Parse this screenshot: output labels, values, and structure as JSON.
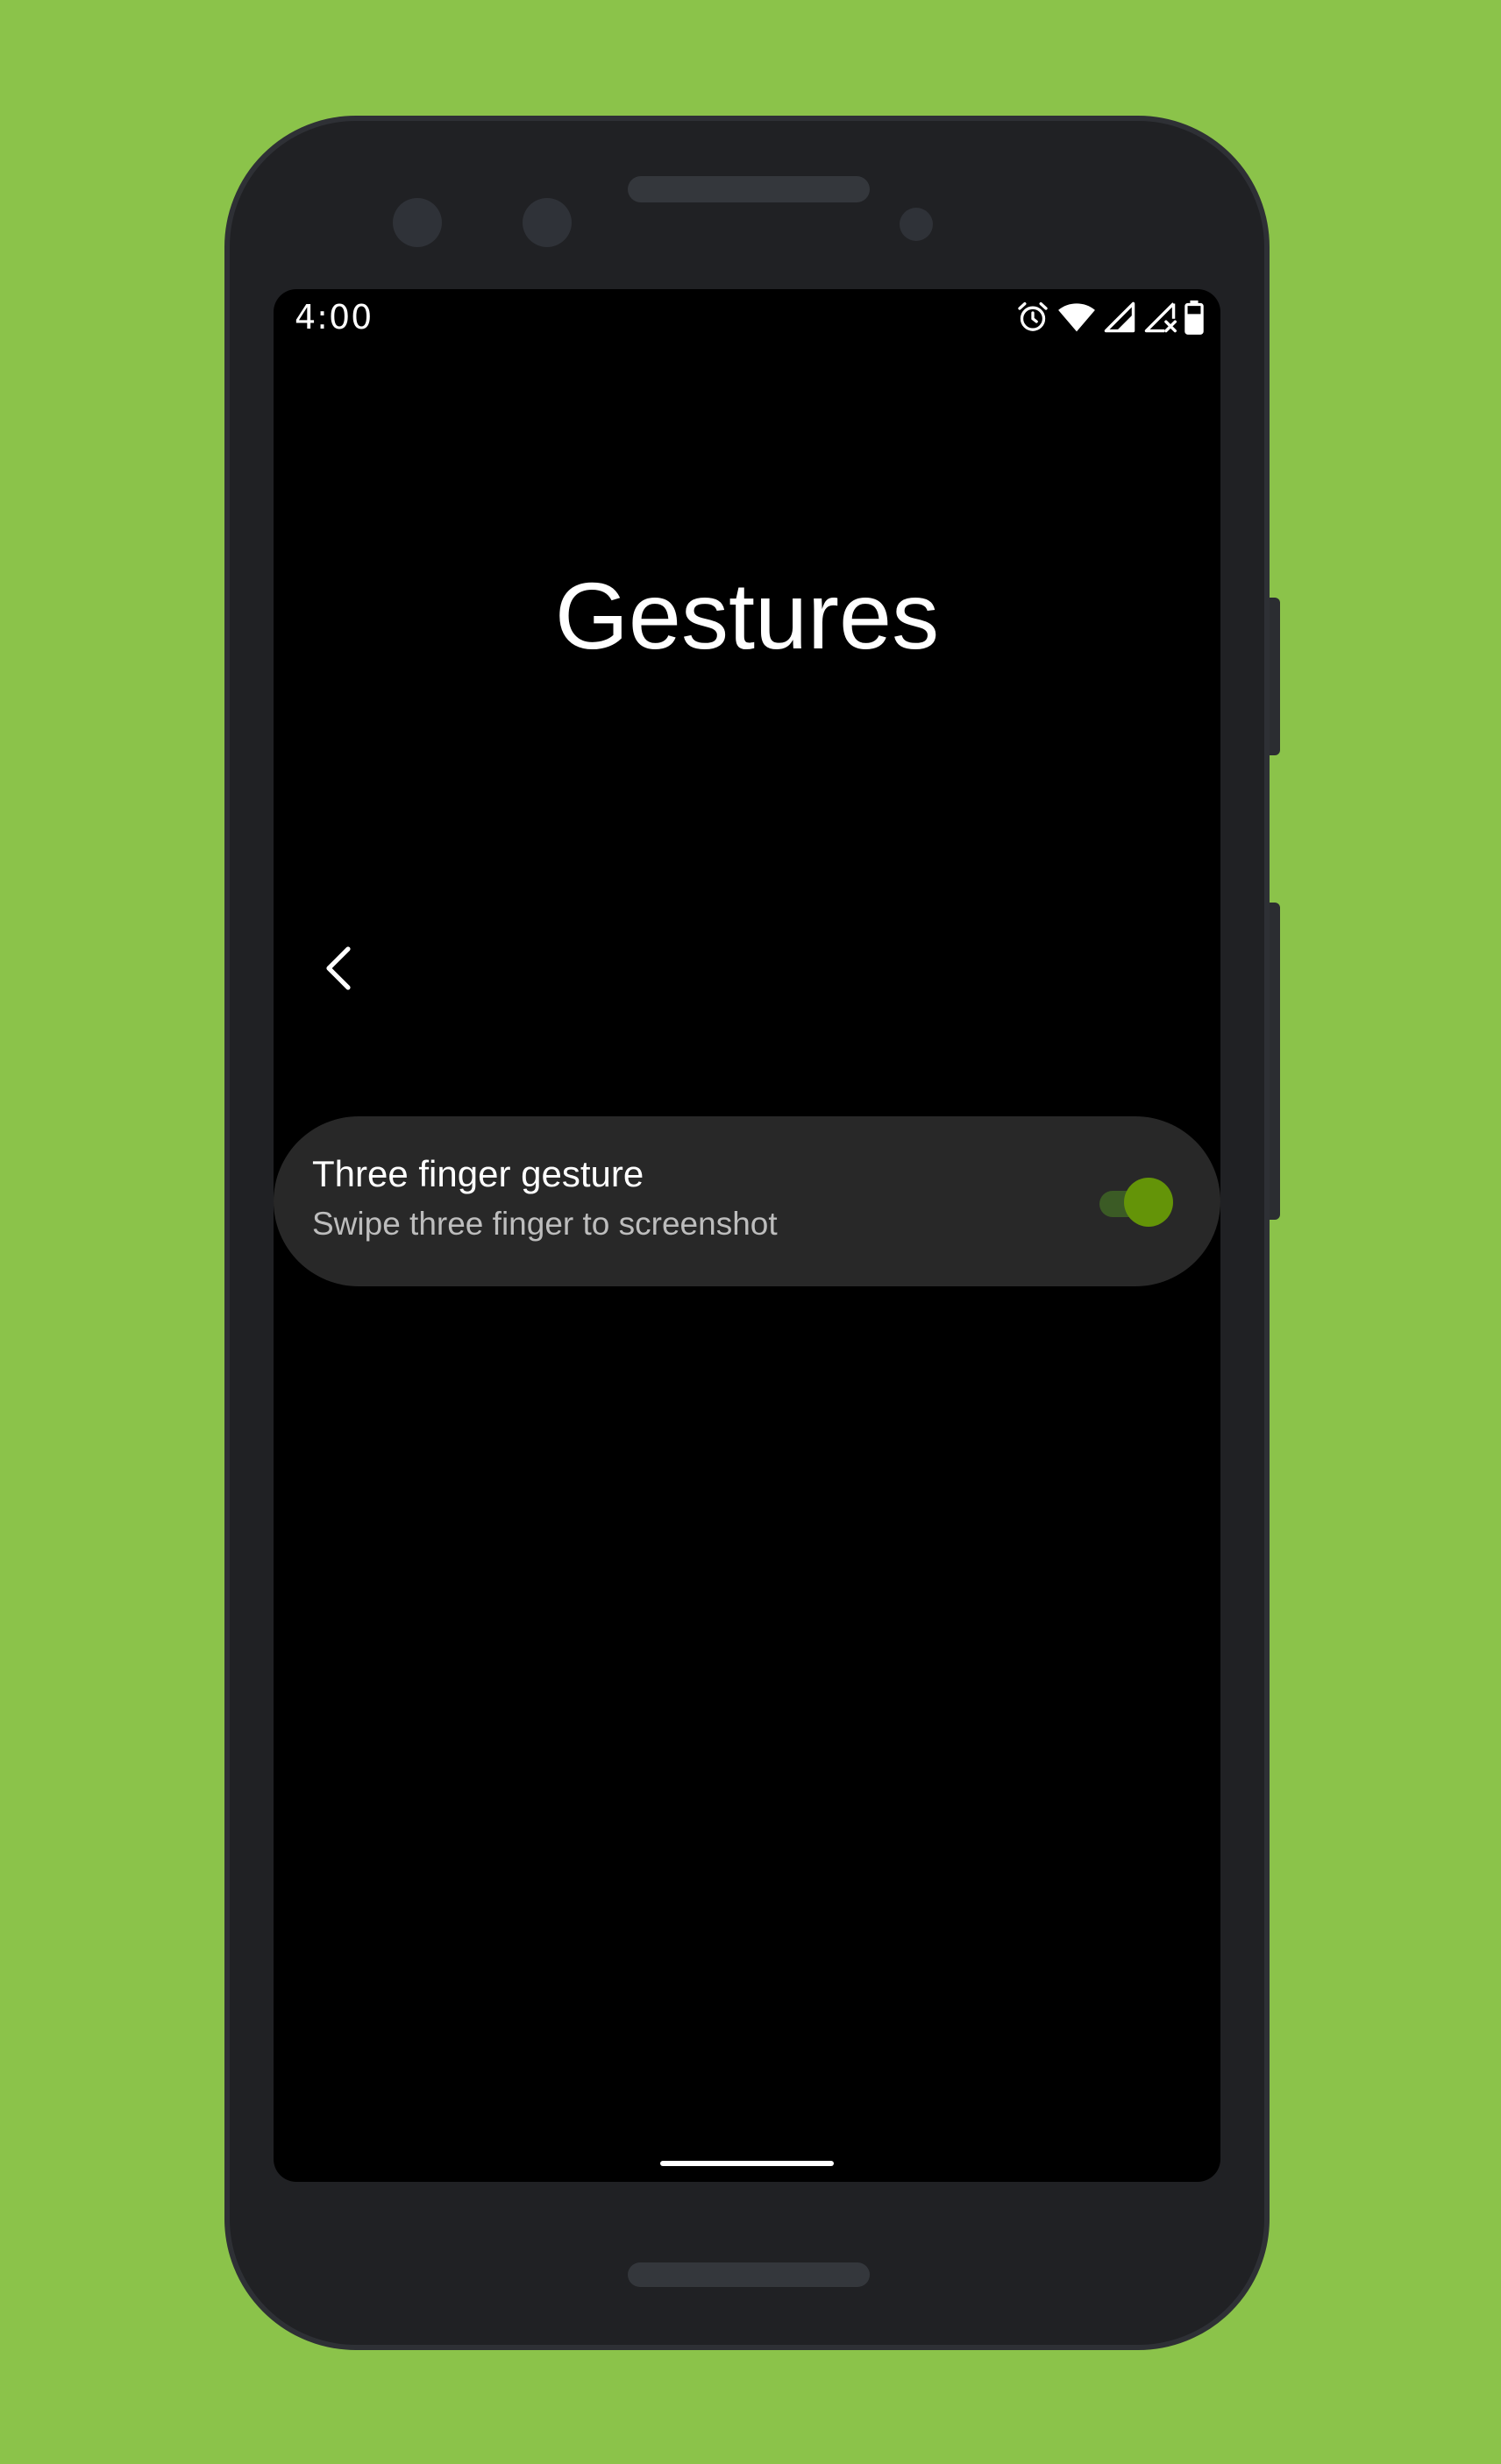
{
  "status_bar": {
    "time": "4:00",
    "icons": [
      "alarm-icon",
      "wifi-icon",
      "signal-icon",
      "signal-no-data-icon",
      "battery-icon"
    ]
  },
  "page": {
    "title": "Gestures"
  },
  "setting": {
    "title": "Three finger gesture",
    "subtitle": "Swipe three finger to screenshot",
    "enabled": true
  },
  "colors": {
    "background": "#8bc34a",
    "screen": "#000000",
    "card": "#282828",
    "toggle_thumb": "#649408",
    "toggle_track": "#3b5b25"
  }
}
